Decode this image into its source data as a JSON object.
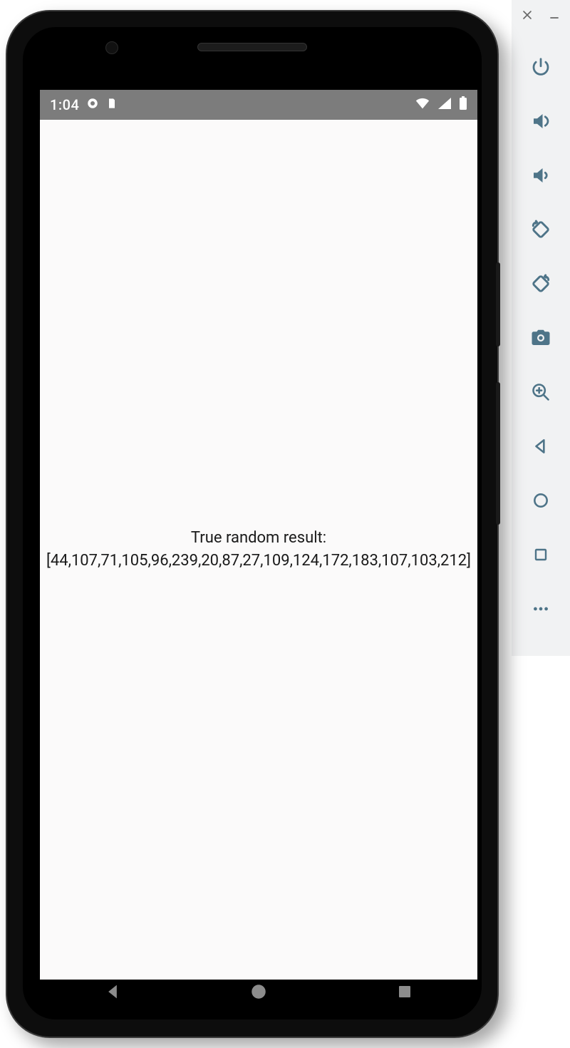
{
  "status_bar": {
    "time": "1:04"
  },
  "app": {
    "title": "True random result:",
    "result": "[44,107,71,105,96,239,20,87,27,109,124,172,183,107,103,212]"
  },
  "emulator_toolbar": {
    "close": "close",
    "minimize": "minimize",
    "power": "power",
    "volume_up": "volume up",
    "volume_down": "volume down",
    "rotate_left": "rotate left",
    "rotate_right": "rotate right",
    "screenshot": "screenshot",
    "zoom": "zoom",
    "back": "back",
    "home": "home",
    "overview": "overview",
    "more": "more"
  },
  "android_nav": {
    "back": "back",
    "home": "home",
    "overview": "overview"
  }
}
